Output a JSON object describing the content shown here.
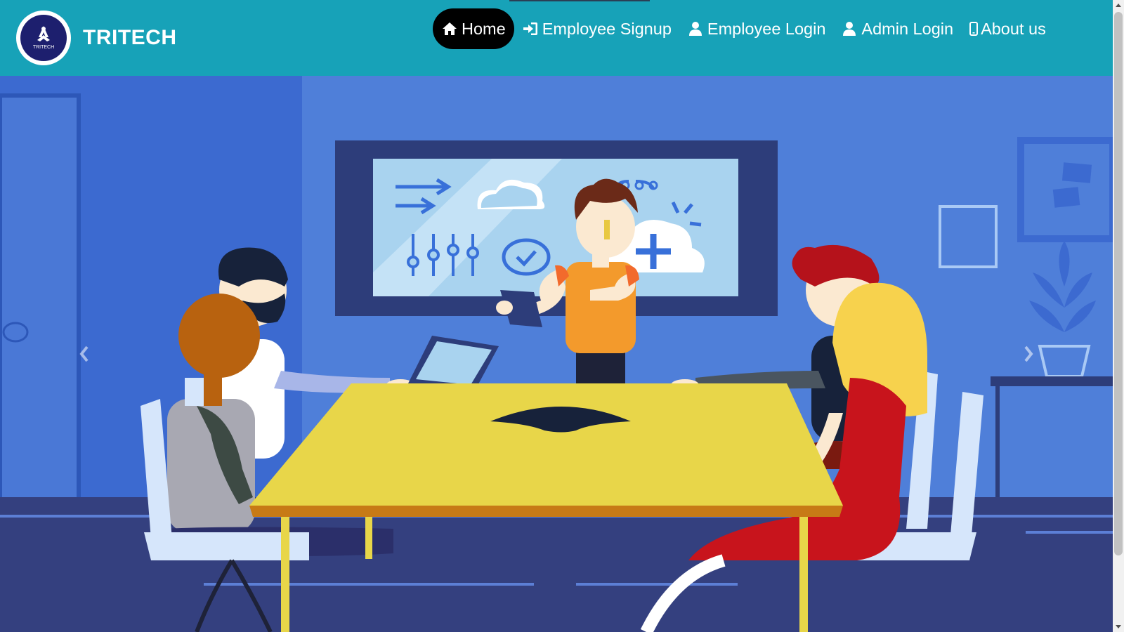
{
  "brand": {
    "name": "TRITECH",
    "logo_text": "TRITECH"
  },
  "nav": {
    "items": [
      {
        "label": "Home",
        "icon": "home-icon",
        "active": true
      },
      {
        "label": "Employee Signup",
        "icon": "sign-in-icon",
        "active": false
      },
      {
        "label": "Employee Login",
        "icon": "user-icon",
        "active": false
      },
      {
        "label": "Admin Login",
        "icon": "user-icon",
        "active": false
      },
      {
        "label": "About us",
        "icon": "mobile-icon",
        "active": false
      }
    ]
  },
  "carousel": {
    "image": "team-meeting-illustration",
    "controls": {
      "prev": "chevron-left-icon",
      "next": "chevron-right-icon"
    }
  },
  "colors": {
    "navbar": "#17a2b8",
    "active_pill": "#000000",
    "wall": "#4f7fd9",
    "table": "#e8d649"
  }
}
